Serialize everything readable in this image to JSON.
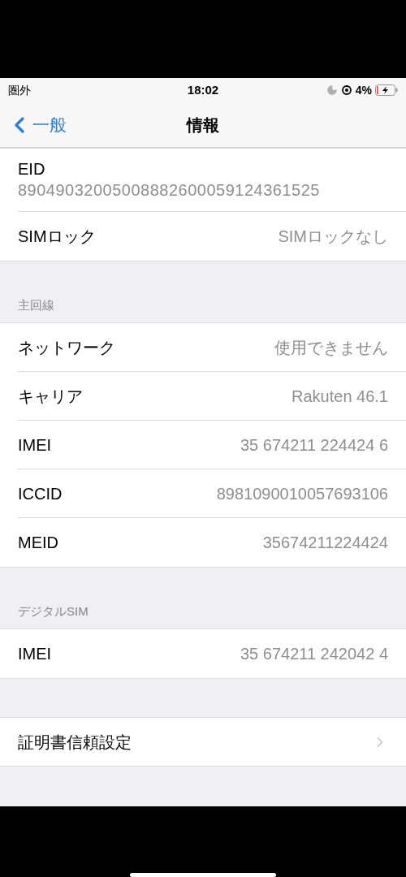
{
  "status_bar": {
    "carrier": "圏外",
    "time": "18:02",
    "battery": "4%"
  },
  "nav": {
    "back": "一般",
    "title": "情報"
  },
  "sections": [
    {
      "rows": [
        {
          "kind": "stacked",
          "label": "EID",
          "value": "89049032005008882600059124361525"
        },
        {
          "kind": "value",
          "label": "SIMロック",
          "value": "SIMロックなし"
        }
      ]
    },
    {
      "header": "主回線",
      "rows": [
        {
          "kind": "value",
          "label": "ネットワーク",
          "value": "使用できません"
        },
        {
          "kind": "value",
          "label": "キャリア",
          "value": "Rakuten 46.1"
        },
        {
          "kind": "value",
          "label": "IMEI",
          "value": "35 674211 224424 6"
        },
        {
          "kind": "value",
          "label": "ICCID",
          "value": "8981090010057693106"
        },
        {
          "kind": "value",
          "label": "MEID",
          "value": "35674211224424"
        }
      ]
    },
    {
      "header": "デジタルSIM",
      "rows": [
        {
          "kind": "value",
          "label": "IMEI",
          "value": "35 674211 242042 4"
        }
      ]
    },
    {
      "rows": [
        {
          "kind": "link",
          "label": "証明書信頼設定"
        }
      ]
    }
  ]
}
